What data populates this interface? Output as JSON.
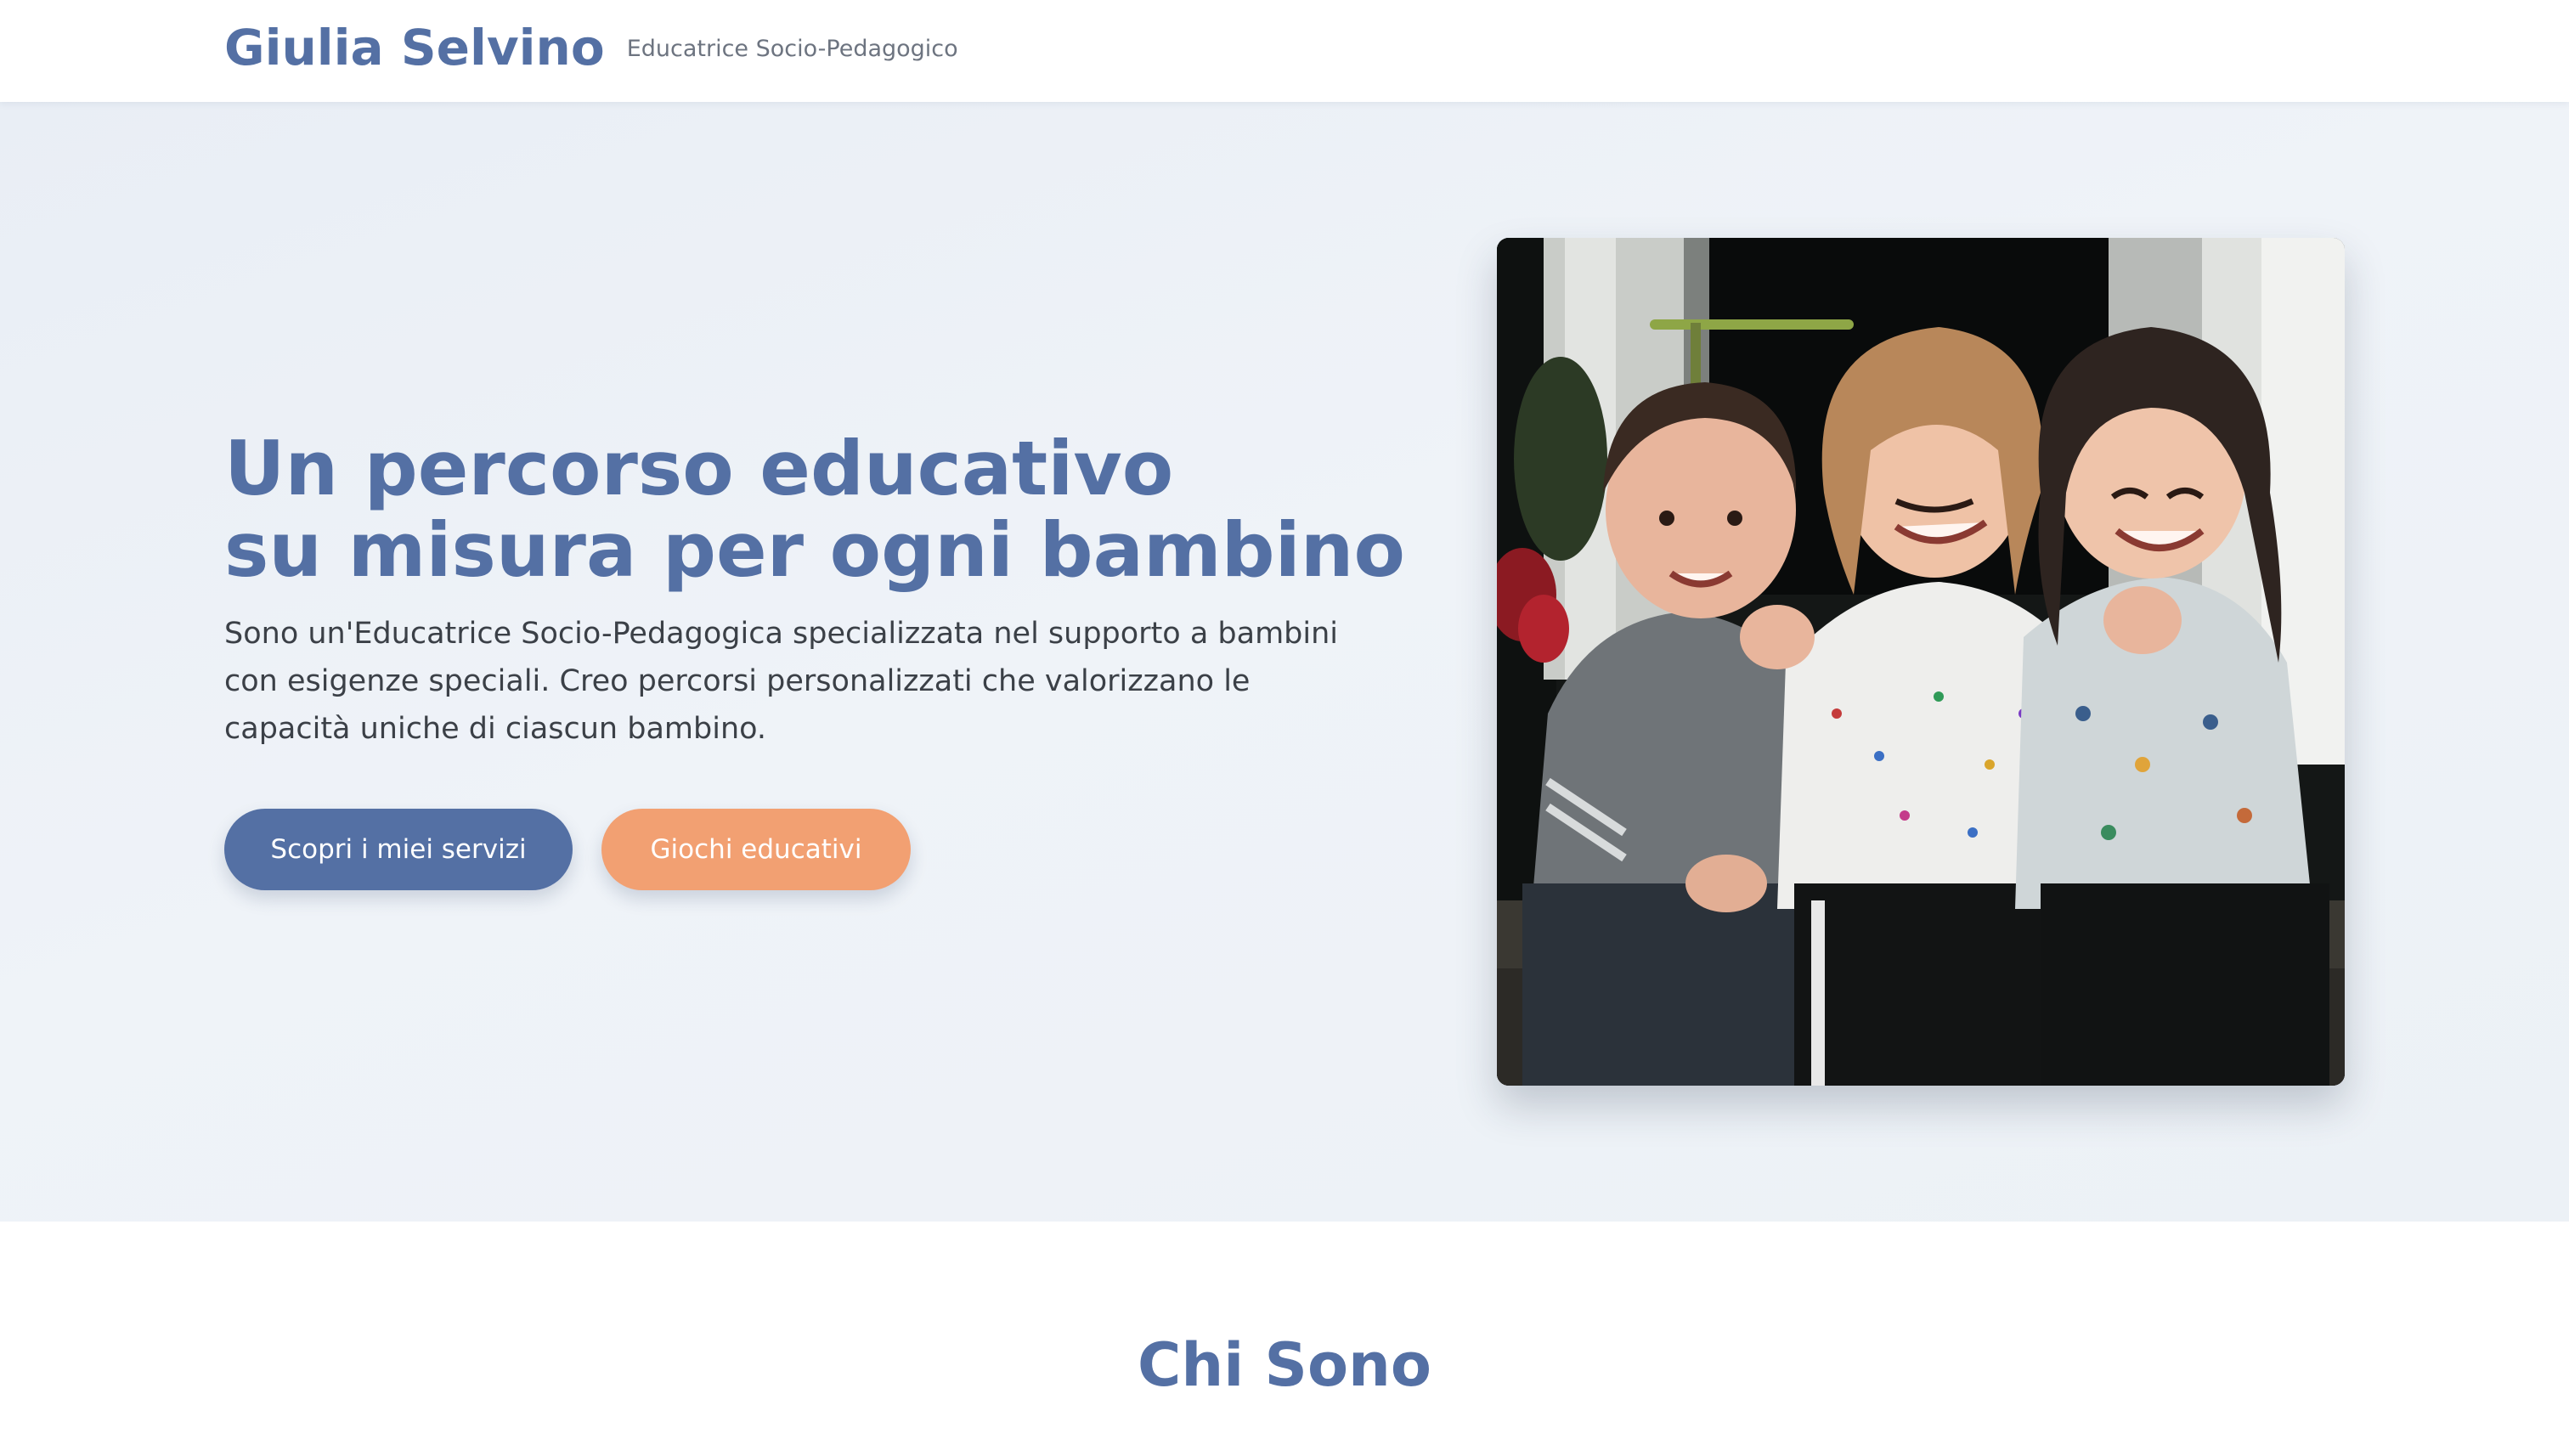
{
  "header": {
    "brand_name": "Giulia Selvino",
    "tagline": "Educatrice Socio-Pedagogico"
  },
  "hero": {
    "title_line1": "Un percorso educativo",
    "title_line2": "su misura per ogni bambino",
    "description": "Sono un'Educatrice Socio-Pedagogica specializzata nel supporto a bambini con esigenze speciali. Creo percorsi personalizzati che valorizzano le capacità uniche di ciascun bambino.",
    "primary_button": "Scopri i miei servizi",
    "secondary_button": "Giochi educativi",
    "image": "photo of three smiling children sitting together on a step"
  },
  "about": {
    "title": "Chi Sono"
  },
  "colors": {
    "brand_blue": "#5470a4",
    "accent_orange": "#f2a072",
    "hero_background": "#eef2f7",
    "body_text": "#3b4047",
    "muted_text": "#6d7480"
  }
}
